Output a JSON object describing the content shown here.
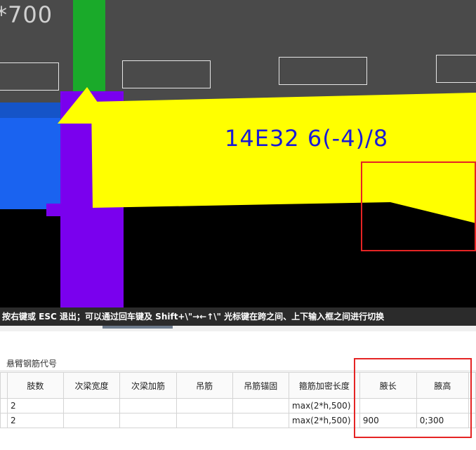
{
  "viewport": {
    "dimension_text": "*700",
    "beam_label": "14E32 6(-4)/8"
  },
  "status_bar": {
    "text": "按右键或 ESC 退出；可以通过回车键及 Shift+\\\"→←↑\\\" 光标键在跨之间、上下输入框之间进行切换"
  },
  "panel": {
    "title": "悬臂钢筋代号",
    "columns": [
      "",
      "肢数",
      "次梁宽度",
      "次梁加筋",
      "吊筋",
      "吊筋锚固",
      "箍筋加密长度",
      "腋长",
      "腋高",
      ""
    ],
    "rows": [
      [
        "",
        "2",
        "",
        "",
        "",
        "",
        "max(2*h,500)",
        "",
        "",
        ""
      ],
      [
        "",
        "2",
        "",
        "",
        "",
        "",
        "max(2*h,500)",
        "900",
        "0;300",
        ""
      ]
    ]
  },
  "colors": {
    "beam_yellow": "#ffff00",
    "highlight_red": "#e52424",
    "label_blue": "#1a1ad6",
    "column_purple": "#7a00ee",
    "column_green": "#1aaa2a"
  }
}
